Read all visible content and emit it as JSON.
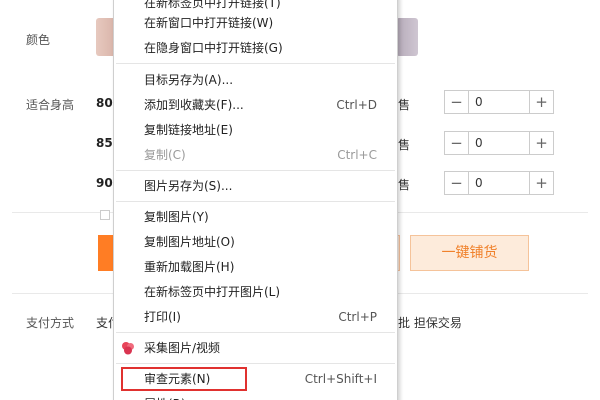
{
  "product_form": {
    "color_label": "颜色",
    "size_label": "适合身高",
    "sizes": [
      {
        "value": "80",
        "sell_text": "售",
        "qty": "0",
        "minus": "−",
        "plus": "+"
      },
      {
        "value": "85",
        "sell_text": "售",
        "qty": "0",
        "minus": "−",
        "plus": "+"
      },
      {
        "value": "90",
        "sell_text": "售",
        "qty": "0",
        "minus": "−",
        "plus": "+"
      }
    ],
    "one_click_button": "一键铺货",
    "payment_label": "支付方式",
    "payment_partial": "支付",
    "payment_right": "批  担保交易"
  },
  "context_menu": {
    "items": [
      {
        "label": "在新标签页中打开链接(T)",
        "shortcut": ""
      },
      {
        "label": "在新窗口中打开链接(W)",
        "shortcut": ""
      },
      {
        "label": "在隐身窗口中打开链接(G)",
        "shortcut": ""
      },
      {
        "label": "目标另存为(A)...",
        "shortcut": ""
      },
      {
        "label": "添加到收藏夹(F)...",
        "shortcut": "Ctrl+D"
      },
      {
        "label": "复制链接地址(E)",
        "shortcut": ""
      },
      {
        "label": "复制(C)",
        "shortcut": "Ctrl+C",
        "disabled": true
      },
      {
        "label": "图片另存为(S)...",
        "shortcut": ""
      },
      {
        "label": "复制图片(Y)",
        "shortcut": ""
      },
      {
        "label": "复制图片地址(O)",
        "shortcut": ""
      },
      {
        "label": "重新加载图片(H)",
        "shortcut": ""
      },
      {
        "label": "在新标签页中打开图片(L)",
        "shortcut": ""
      },
      {
        "label": "打印(I)",
        "shortcut": "Ctrl+P"
      },
      {
        "label": "采集图片/视频",
        "shortcut": "",
        "icon": "flower-icon"
      },
      {
        "label": "审查元素(N)",
        "shortcut": "Ctrl+Shift+I",
        "highlighted": true
      },
      {
        "label": "属性(R)",
        "shortcut": ""
      }
    ],
    "highlight_color": "#e0312f"
  },
  "colors": {
    "accent_orange": "#ff7d24",
    "button_text": "#f0812b"
  }
}
